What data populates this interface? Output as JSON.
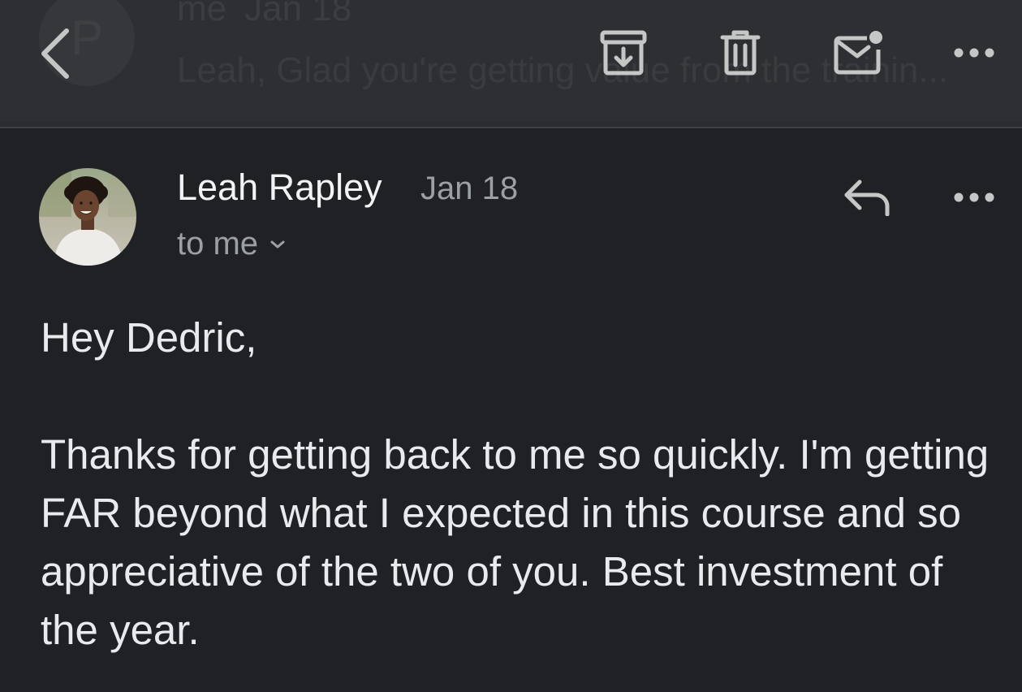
{
  "toolbar": {
    "back_icon": "chevron-left-icon",
    "archive_icon": "archive-icon",
    "delete_icon": "trash-icon",
    "mark_unread_icon": "mail-unread-icon",
    "more_icon": "more-horizontal-icon"
  },
  "previous_message": {
    "avatar_initial": "P",
    "sender": "me",
    "date": "Jan 18",
    "snippet": "Leah, Glad you're getting value from the trainin..."
  },
  "message": {
    "sender_name": "Leah Rapley",
    "date": "Jan 18",
    "recipient": "to me",
    "reply_icon": "reply-icon",
    "more_icon": "more-horizontal-icon",
    "greeting": "Hey Dedric,",
    "body": "Thanks for getting back to me so quickly. I'm getting FAR beyond what I expected in this course and so appreciative of the two of you. Best investment of the year."
  },
  "colors": {
    "background": "#202124",
    "toolbar": "#2e2f32",
    "primary_text": "#e8eaed",
    "secondary_text": "#9aa0a6",
    "icon": "#c4c7c5"
  }
}
